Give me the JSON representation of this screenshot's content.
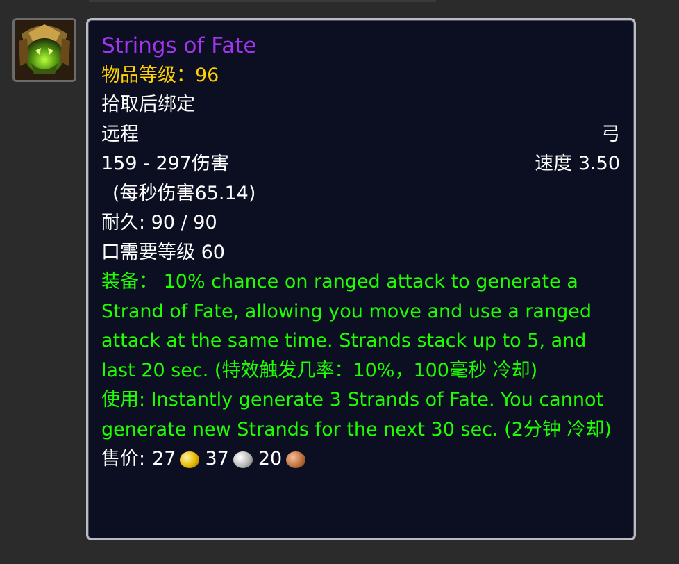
{
  "item": {
    "name": "Strings of Fate",
    "item_level": "物品等级：96",
    "bind": "拾取后绑定",
    "slot": "远程",
    "type": "弓",
    "damage": "159 - 297伤害",
    "speed": "速度 3.50",
    "dps": "(每秒伤害65.14)",
    "durability": "耐久: 90 / 90",
    "required_level": "口需要等级 60",
    "equip_text": "装备：  10% chance on ranged attack to generate a Strand of Fate, allowing you move and use a ranged attack at the same time. Strands stack up to 5, and last 20 sec. (特效触发几率：10%，100毫秒 冷却)",
    "use_text": "使用: Instantly generate 3 Strands of Fate. You cannot generate new Strands for the next 30 sec. (2分钟 冷却)",
    "sell_label": "售价:",
    "gold": "27",
    "silver": "37",
    "copper": "20",
    "icon": "item-icon-bow"
  },
  "colors": {
    "epic": "#a335ee",
    "item_level": "#ffd100",
    "green": "#1eff00",
    "background": "#0c0f22"
  }
}
